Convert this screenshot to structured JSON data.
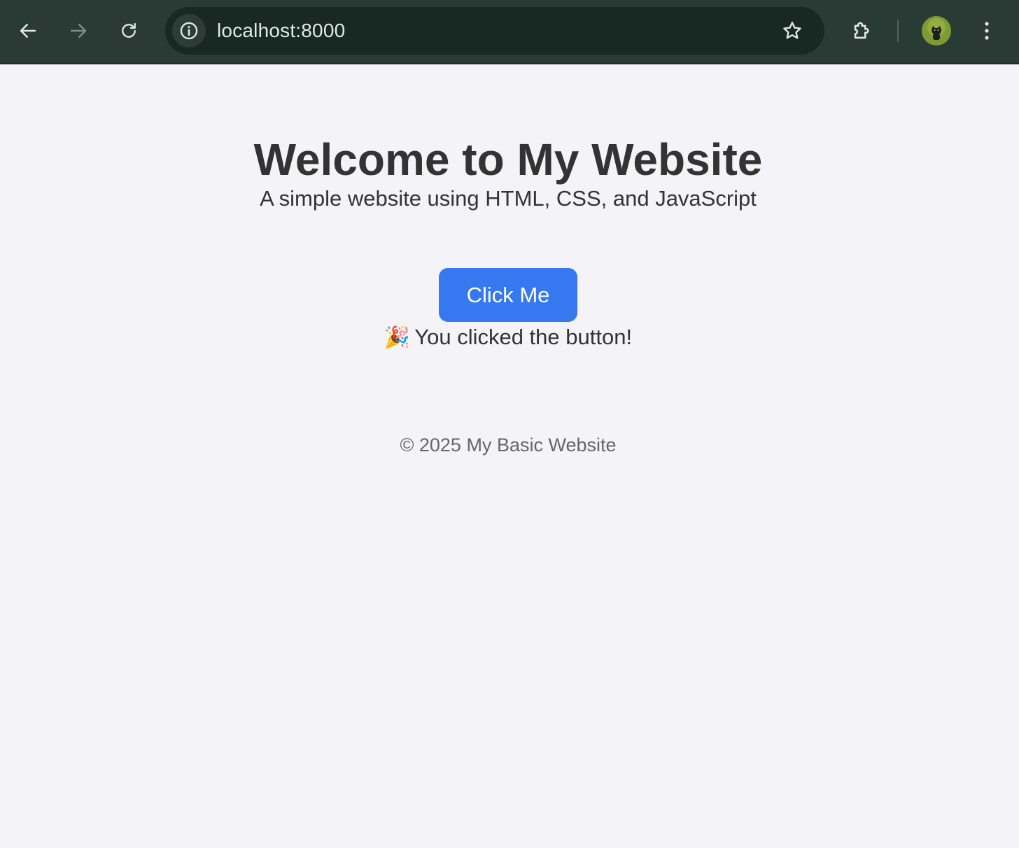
{
  "browser": {
    "url": "localhost:8000",
    "theme_color": "#2a3b35"
  },
  "icons": {
    "back": "arrow-left-icon",
    "forward": "arrow-right-icon",
    "reload": "reload-icon",
    "site_info": "info-icon",
    "bookmark": "star-icon",
    "extensions": "puzzle-icon",
    "menu": "kebab-menu-icon",
    "party": "🎉"
  },
  "page": {
    "title": "Welcome to My Website",
    "subtitle": "A simple website using HTML, CSS, and JavaScript",
    "button_label": "Click Me",
    "message": "You clicked the button!",
    "footer": "© 2025 My Basic Website",
    "accent_color": "#3578f0",
    "background_color": "#f4f4f8"
  }
}
